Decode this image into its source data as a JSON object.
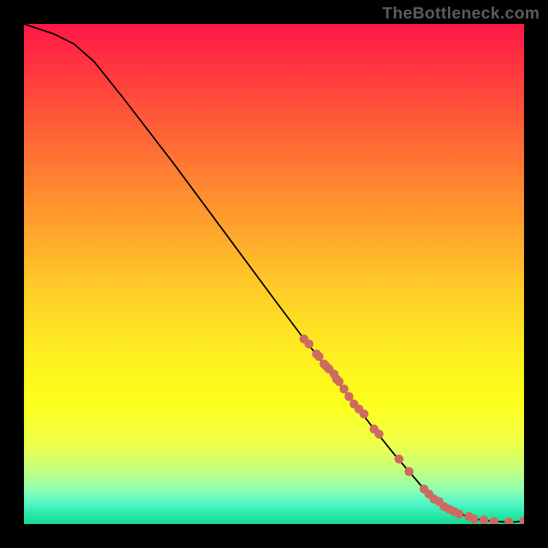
{
  "attribution": "TheBottleneck.com",
  "chart_data": {
    "type": "line",
    "title": "",
    "xlabel": "",
    "ylabel": "",
    "xlim": [
      0,
      100
    ],
    "ylim": [
      0,
      100
    ],
    "series": [
      {
        "name": "curve",
        "style": "line",
        "color": "#000000",
        "x": [
          0,
          3,
          6,
          10,
          14,
          20,
          30,
          40,
          50,
          56,
          60,
          65,
          70,
          74,
          77,
          80,
          83,
          86,
          90,
          94,
          98,
          100
        ],
        "y": [
          100,
          99,
          98,
          96,
          92.5,
          85,
          72,
          58.5,
          45,
          37,
          32,
          25.5,
          19,
          14,
          10.5,
          7,
          4.5,
          2.5,
          1,
          0.5,
          0.4,
          0.6
        ]
      },
      {
        "name": "points",
        "style": "scatter",
        "color": "#cf6a60",
        "x": [
          56,
          57,
          58.5,
          59,
          60,
          60.5,
          61,
          62,
          62.5,
          63,
          64,
          65,
          66,
          67,
          68,
          70,
          71,
          75,
          77,
          80,
          81,
          82,
          83,
          84,
          85,
          86,
          87,
          89,
          90,
          92,
          94,
          97,
          100
        ],
        "y": [
          37,
          36,
          34,
          33.5,
          32,
          31.5,
          31,
          30,
          29,
          28.5,
          27,
          25.5,
          24,
          23,
          22,
          19,
          18,
          13,
          10.5,
          7,
          6,
          5,
          4.5,
          3.5,
          3,
          2.5,
          2,
          1.5,
          1,
          0.8,
          0.5,
          0.4,
          0.6
        ]
      }
    ]
  }
}
